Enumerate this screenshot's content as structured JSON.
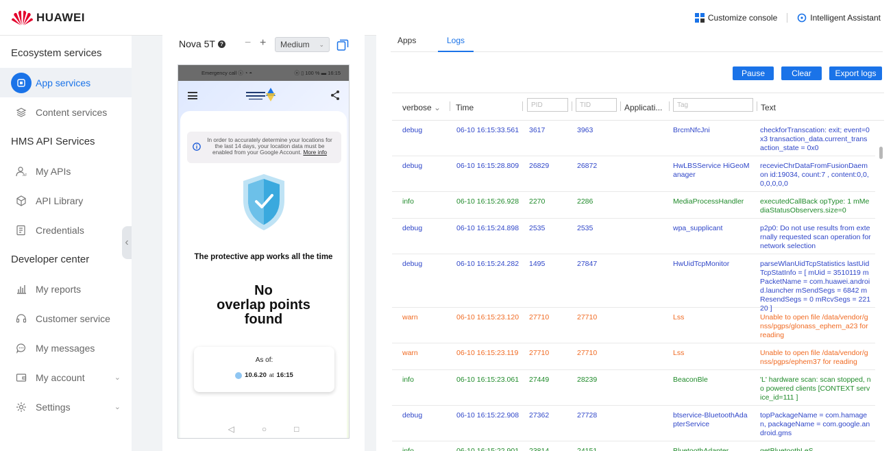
{
  "header": {
    "brand": "HUAWEI",
    "customize_label": "Customize console",
    "assistant_label": "Intelligent Assistant"
  },
  "sidebar": {
    "sections": [
      {
        "title": "Ecosystem services"
      },
      {
        "title": "HMS API Services"
      },
      {
        "title": "Developer center"
      }
    ],
    "items": [
      {
        "label": "App services",
        "icon": "app-services-icon"
      },
      {
        "label": "Content services",
        "icon": "layers-icon"
      },
      {
        "label": "My APIs",
        "icon": "api-user-icon"
      },
      {
        "label": "API Library",
        "icon": "cube-icon"
      },
      {
        "label": "Credentials",
        "icon": "credentials-icon"
      },
      {
        "label": "My reports",
        "icon": "bar-chart-icon"
      },
      {
        "label": "Customer service",
        "icon": "headset-icon"
      },
      {
        "label": "My messages",
        "icon": "chat-icon"
      },
      {
        "label": "My account",
        "icon": "wallet-icon"
      },
      {
        "label": "Settings",
        "icon": "gear-icon"
      }
    ]
  },
  "device": {
    "name": "Nova 5T",
    "zoom_minus": "−",
    "zoom_plus": "+",
    "size": "Medium",
    "status_left": "Emergency call ⓢ ◔ ◓",
    "status_right": "ⓝ ▯ 100 % ▬ 16:15",
    "info_text": "In order to accurately determine your locations for the last 14 days, your location data must be enabled from your Google Account.",
    "info_more": "More info",
    "protect_text": "The protective app works all the time",
    "no_overlap_line1": "No",
    "no_overlap_line2": "overlap points",
    "no_overlap_line3": "found",
    "asof_label": "As of:",
    "asof_date": "10.6.20",
    "asof_at": "at",
    "asof_time": "16:15"
  },
  "logs": {
    "tabs": [
      "Apps",
      "Logs"
    ],
    "active_tab": "Logs",
    "buttons": {
      "pause": "Pause",
      "clear": "Clear",
      "export": "Export logs"
    },
    "columns": {
      "level": "verbose",
      "time": "Time",
      "pid_placeholder": "PID",
      "tid_placeholder": "TID",
      "application": "Applicati...",
      "tag_placeholder": "Tag",
      "text": "Text"
    },
    "rows": [
      {
        "level": "debug",
        "time": "06-10 16:15:33.561",
        "pid": "3617",
        "tid": "3963",
        "tag": "BrcmNfcJni",
        "text": "checkforTranscation: exit; event=0x3 transaction_data.current_transaction_state = 0x0"
      },
      {
        "level": "debug",
        "time": "06-10 16:15:28.809",
        "pid": "26829",
        "tid": "26872",
        "tag": "HwLBSService HiGeoManager",
        "text": "recevieChrDataFromFusionDaemon id:19034, count:7 , content:0,0,0,0,0,0,0"
      },
      {
        "level": "info",
        "time": "06-10 16:15:26.928",
        "pid": "2270",
        "tid": "2286",
        "tag": "MediaProcessHandler",
        "text": "executedCallBack opType: 1 mMediaStatusObservers.size=0"
      },
      {
        "level": "debug",
        "time": "06-10 16:15:24.898",
        "pid": "2535",
        "tid": "2535",
        "tag": "wpa_supplicant",
        "text": "p2p0: Do not use results from externally requested scan operation for network selection"
      },
      {
        "level": "debug",
        "time": "06-10 16:15:24.282",
        "pid": "1495",
        "tid": "27847",
        "tag": "HwUidTcpMonitor",
        "text": "parseWlanUidTcpStatistics lastUidTcpStatInfo = [ mUid = 3510119 mPacketName = com.huawei.android.launcher mSendSegs = 6842 mResendSegs = 0 mRcvSegs = 22120 ]"
      },
      {
        "level": "warn",
        "time": "06-10 16:15:23.120",
        "pid": "27710",
        "tid": "27710",
        "tag": "Lss",
        "text": "Unable to open file /data/vendor/gnss/pgps/glonass_ephem_a23 for reading"
      },
      {
        "level": "warn",
        "time": "06-10 16:15:23.119",
        "pid": "27710",
        "tid": "27710",
        "tag": "Lss",
        "text": "Unable to open file /data/vendor/gnss/pgps/ephem37 for reading"
      },
      {
        "level": "info",
        "time": "06-10 16:15:23.061",
        "pid": "27449",
        "tid": "28239",
        "tag": "BeaconBle",
        "text": "'L' hardware scan: scan stopped, no powered clients [CONTEXT service_id=111 ]"
      },
      {
        "level": "debug",
        "time": "06-10 16:15:22.908",
        "pid": "27362",
        "tid": "27728",
        "tag": "btservice-BluetoothAdapterService",
        "text": "topPackageName = com.hamagen, packageName = com.google.android.gms"
      },
      {
        "level": "info",
        "time": "06-10 16:15:22.901",
        "pid": "23814",
        "tid": "24151",
        "tag": "BluetoothAdapter",
        "text": "getBluetoothLeS"
      }
    ]
  },
  "colors": {
    "accent": "#1a73e8",
    "debug": "#2f46c8",
    "info": "#1f8a2a",
    "warn": "#f06a22"
  }
}
